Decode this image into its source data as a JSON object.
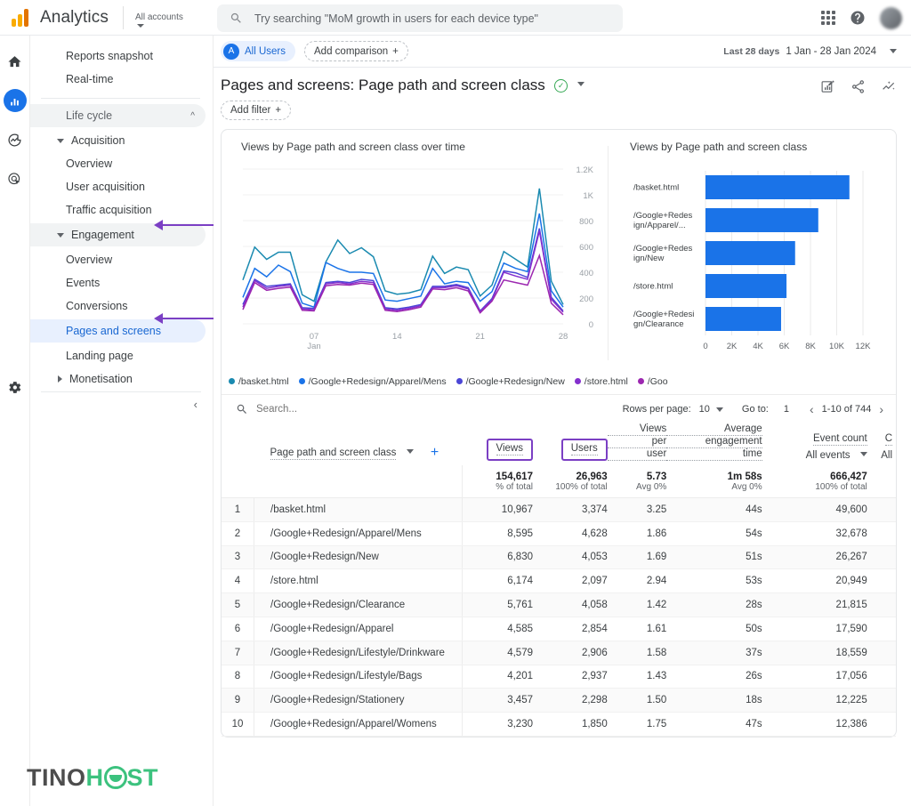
{
  "topbar": {
    "brand": "Analytics",
    "account_label": "All accounts",
    "search_placeholder": "Try searching \"MoM growth in users for each device type\"",
    "search_value": "",
    "icons": {
      "search": "search-icon",
      "apps": "apps-grid-icon",
      "help": "help-circle-icon",
      "avatar": "user-avatar"
    }
  },
  "rail": {
    "items": [
      {
        "name": "home-icon",
        "label": "Home",
        "active": false
      },
      {
        "name": "reports-icon",
        "label": "Reports",
        "active": true
      },
      {
        "name": "explore-icon",
        "label": "Explore",
        "active": false
      },
      {
        "name": "advertising-icon",
        "label": "Advertising",
        "active": false
      }
    ],
    "settings_label": "Admin"
  },
  "sidebar": {
    "items": [
      {
        "label": "Reports snapshot",
        "level": 1,
        "type": "item"
      },
      {
        "label": "Real-time",
        "level": 1,
        "type": "item"
      },
      {
        "label": "Life cycle",
        "level": 1,
        "type": "section"
      },
      {
        "label": "Acquisition",
        "level": 1,
        "type": "group-open"
      },
      {
        "label": "Overview",
        "level": 2,
        "type": "item"
      },
      {
        "label": "User acquisition",
        "level": 2,
        "type": "item"
      },
      {
        "label": "Traffic acquisition",
        "level": 2,
        "type": "item"
      },
      {
        "label": "Engagement",
        "level": 1,
        "type": "group-open-hl"
      },
      {
        "label": "Overview",
        "level": 2,
        "type": "item"
      },
      {
        "label": "Events",
        "level": 2,
        "type": "item"
      },
      {
        "label": "Conversions",
        "level": 2,
        "type": "item"
      },
      {
        "label": "Pages and screens",
        "level": 2,
        "type": "selected"
      },
      {
        "label": "Landing page",
        "level": 2,
        "type": "item"
      },
      {
        "label": "Monetisation",
        "level": 1,
        "type": "group-closed"
      }
    ],
    "collapse_label": "‹"
  },
  "audience_bar": {
    "all_users_label": "All Users",
    "all_users_initial": "A",
    "add_comparison_label": "Add comparison",
    "add_comparison_plus": "+",
    "date_prefix": "Last 28 days",
    "date_range": "1 Jan - 28 Jan 2024"
  },
  "report": {
    "title": "Pages and screens: Page path and screen class",
    "status_glyph": "✓",
    "add_filter_label": "Add filter",
    "add_filter_plus": "+",
    "actions": [
      "customize-report-icon",
      "share-icon",
      "insights-icon"
    ]
  },
  "line_chart_title": "Views by Page path and screen class over time",
  "bar_chart_title": "Views by Page path and screen class",
  "legend": [
    {
      "label": "/basket.html",
      "color": "#1a8ab0"
    },
    {
      "label": "/Google+Redesign/Apparel/Mens",
      "color": "#1a73e8"
    },
    {
      "label": "/Google+Redesign/New",
      "color": "#4b46d6"
    },
    {
      "label": "/store.html",
      "color": "#8430ce"
    },
    {
      "label": "/Goo",
      "color": "#9c27b0"
    }
  ],
  "table_controls": {
    "search_placeholder": "Search...",
    "rows_per_page_label": "Rows per page:",
    "rows_per_page_value": "10",
    "go_to_label": "Go to:",
    "go_to_value": "1",
    "range_label": "1-10 of 744",
    "prev_glyph": "‹",
    "next_glyph": "›"
  },
  "table": {
    "dimension_header": "Page path and screen class",
    "add_dimension_plus": "+",
    "columns": [
      {
        "label": "Views",
        "highlighted": true
      },
      {
        "label": "Users",
        "highlighted": true
      },
      {
        "label": "Views per user",
        "highlighted": false
      },
      {
        "label": "Average engagement time",
        "highlighted": false
      },
      {
        "label": "Event count",
        "sub": "All events",
        "highlighted": false
      },
      {
        "label": "C",
        "sub": "All",
        "highlighted": false
      }
    ],
    "totals": {
      "views": "154,617",
      "views_sub": "% of total",
      "users": "26,963",
      "users_sub": "100% of total",
      "views_per_user": "5.73",
      "views_per_user_sub": "Avg 0%",
      "avg_engagement": "1m 58s",
      "avg_engagement_sub": "Avg 0%",
      "event_count": "666,427",
      "event_count_sub": "100% of total"
    },
    "rows": [
      {
        "index": "1",
        "path": "/basket.html",
        "views": "10,967",
        "users": "3,374",
        "vpu": "3.25",
        "time": "44s",
        "events": "49,600"
      },
      {
        "index": "2",
        "path": "/Google+Redesign/Apparel/Mens",
        "views": "8,595",
        "users": "4,628",
        "vpu": "1.86",
        "time": "54s",
        "events": "32,678"
      },
      {
        "index": "3",
        "path": "/Google+Redesign/New",
        "views": "6,830",
        "users": "4,053",
        "vpu": "1.69",
        "time": "51s",
        "events": "26,267"
      },
      {
        "index": "4",
        "path": "/store.html",
        "views": "6,174",
        "users": "2,097",
        "vpu": "2.94",
        "time": "53s",
        "events": "20,949"
      },
      {
        "index": "5",
        "path": "/Google+Redesign/Clearance",
        "views": "5,761",
        "users": "4,058",
        "vpu": "1.42",
        "time": "28s",
        "events": "21,815"
      },
      {
        "index": "6",
        "path": "/Google+Redesign/Apparel",
        "views": "4,585",
        "users": "2,854",
        "vpu": "1.61",
        "time": "50s",
        "events": "17,590"
      },
      {
        "index": "7",
        "path": "/Google+Redesign/Lifestyle/Drinkware",
        "views": "4,579",
        "users": "2,906",
        "vpu": "1.58",
        "time": "37s",
        "events": "18,559"
      },
      {
        "index": "8",
        "path": "/Google+Redesign/Lifestyle/Bags",
        "views": "4,201",
        "users": "2,937",
        "vpu": "1.43",
        "time": "26s",
        "events": "17,056"
      },
      {
        "index": "9",
        "path": "/Google+Redesign/Stationery",
        "views": "3,457",
        "users": "2,298",
        "vpu": "1.50",
        "time": "18s",
        "events": "12,225"
      },
      {
        "index": "10",
        "path": "/Google+Redesign/Apparel/Womens",
        "views": "3,230",
        "users": "1,850",
        "vpu": "1.75",
        "time": "47s",
        "events": "12,386"
      }
    ]
  },
  "watermark": {
    "part1": "TIN",
    "part2": "O",
    "part3": "H",
    "part4": "ST"
  },
  "chart_data": [
    {
      "type": "line",
      "title": "Views by Page path and screen class over time",
      "xlabel": "",
      "ylabel": "",
      "ylim": [
        0,
        1200
      ],
      "yticks": [
        0,
        200,
        400,
        600,
        800,
        1000,
        1200
      ],
      "ytick_labels": [
        "0",
        "200",
        "400",
        "600",
        "800",
        "1K",
        "1.2K"
      ],
      "x": [
        1,
        2,
        3,
        4,
        5,
        6,
        7,
        8,
        9,
        10,
        11,
        12,
        13,
        14,
        15,
        16,
        17,
        18,
        19,
        20,
        21,
        22,
        23,
        24,
        25,
        26,
        27,
        28
      ],
      "xticks": [
        7,
        14,
        21,
        28
      ],
      "xtick_labels": [
        "07\nJan",
        "14",
        "21",
        "28"
      ],
      "grid": true,
      "legend_position": "bottom",
      "series": [
        {
          "name": "/basket.html",
          "color": "#1a8ab0",
          "values": [
            340,
            595,
            500,
            555,
            555,
            225,
            175,
            480,
            650,
            545,
            590,
            520,
            255,
            230,
            240,
            265,
            525,
            390,
            440,
            420,
            215,
            300,
            560,
            500,
            440,
            1050,
            330,
            150
          ]
        },
        {
          "name": "/Google+Redesign/Apparel/Mens",
          "color": "#1a73e8",
          "values": [
            205,
            430,
            365,
            455,
            405,
            160,
            130,
            475,
            430,
            400,
            400,
            390,
            185,
            175,
            195,
            215,
            430,
            310,
            330,
            320,
            175,
            250,
            470,
            430,
            405,
            855,
            255,
            130
          ]
        },
        {
          "name": "/Google+Redesign/New",
          "color": "#4b46d6",
          "values": [
            150,
            345,
            290,
            300,
            310,
            125,
            120,
            320,
            330,
            320,
            345,
            335,
            125,
            115,
            130,
            150,
            290,
            290,
            305,
            280,
            100,
            195,
            410,
            395,
            360,
            740,
            205,
            100
          ]
        },
        {
          "name": "/store.html",
          "color": "#8430ce",
          "values": [
            130,
            335,
            275,
            290,
            300,
            115,
            110,
            310,
            320,
            310,
            330,
            320,
            115,
            105,
            120,
            140,
            280,
            280,
            295,
            270,
            95,
            185,
            400,
            370,
            345,
            720,
            190,
            90
          ]
        },
        {
          "name": "/Goo",
          "color": "#9c27b0",
          "values": [
            110,
            320,
            260,
            275,
            285,
            105,
            100,
            295,
            305,
            300,
            315,
            305,
            105,
            95,
            110,
            130,
            270,
            265,
            280,
            255,
            85,
            175,
            340,
            320,
            300,
            530,
            160,
            70
          ]
        }
      ]
    },
    {
      "type": "bar",
      "orientation": "horizontal",
      "title": "Views by Page path and screen class",
      "categories": [
        "/basket.html",
        "/Google+Redes\nign/Apparel/...",
        "/Google+Redes\nign/New",
        "/store.html",
        "/Google+Redesi\ngn/Clearance"
      ],
      "values": [
        10967,
        8595,
        6830,
        6174,
        5761
      ],
      "xlim": [
        0,
        12000
      ],
      "xticks": [
        0,
        2000,
        4000,
        6000,
        8000,
        10000,
        12000
      ],
      "xtick_labels": [
        "0",
        "2K",
        "4K",
        "6K",
        "8K",
        "10K",
        "12K"
      ],
      "bar_color": "#1a73e8",
      "grid": true
    }
  ]
}
